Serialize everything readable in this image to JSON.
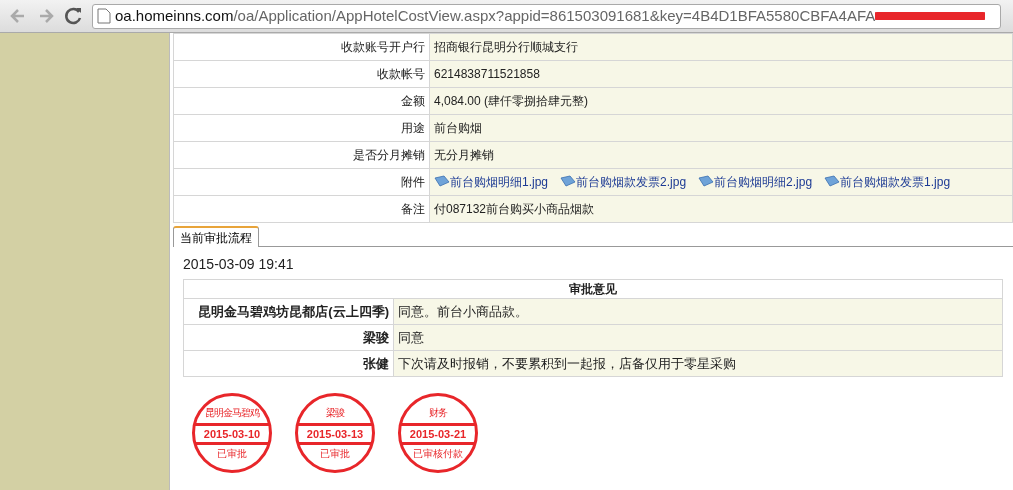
{
  "browser": {
    "url_host": "oa.homeinns.com",
    "url_path": "/oa/Application/AppHotelCostView.aspx?appid=861503091681&key=4B4D1BFA5580CBFA4AFA"
  },
  "details": [
    {
      "kind": "text",
      "label": "收款账号开户行",
      "value": "招商银行昆明分行顺城支行"
    },
    {
      "kind": "text",
      "label": "收款帐号",
      "value": "6214838711521858"
    },
    {
      "kind": "text",
      "label": "金额",
      "value": "4,084.00 (肆仟零捌拾肆元整)"
    },
    {
      "kind": "text",
      "label": "用途",
      "value": "前台购烟"
    },
    {
      "kind": "text",
      "label": "是否分月摊销",
      "value": "无分月摊销"
    },
    {
      "kind": "files",
      "label": "附件",
      "files": [
        "前台购烟明细1.jpg",
        "前台购烟款发票2.jpg",
        "前台购烟明细2.jpg",
        "前台购烟款发票1.jpg"
      ]
    },
    {
      "kind": "text",
      "label": "备注",
      "value": "付087132前台购买小商品烟款"
    }
  ],
  "tabs": [
    {
      "label": "当前审批流程",
      "selected": true
    }
  ],
  "approval": {
    "timestamp": "2015-03-09 19:41",
    "heading": "审批意见",
    "rows": [
      {
        "approver": "昆明金马碧鸡坊昆都店(云上四季)",
        "opinion": "同意。前台小商品款。"
      },
      {
        "approver": "梁骏",
        "opinion": "同意"
      },
      {
        "approver": "张健",
        "opinion": "下次请及时报销，不要累积到一起报，店备仅用于零星采购"
      }
    ]
  },
  "stamps": [
    {
      "top": "昆明金马碧鸡",
      "date": "2015-03-10",
      "bottom": "已审批"
    },
    {
      "top": "梁骏",
      "date": "2015-03-13",
      "bottom": "已审批"
    },
    {
      "top": "财务",
      "date": "2015-03-21",
      "bottom": "已审核付款"
    }
  ]
}
